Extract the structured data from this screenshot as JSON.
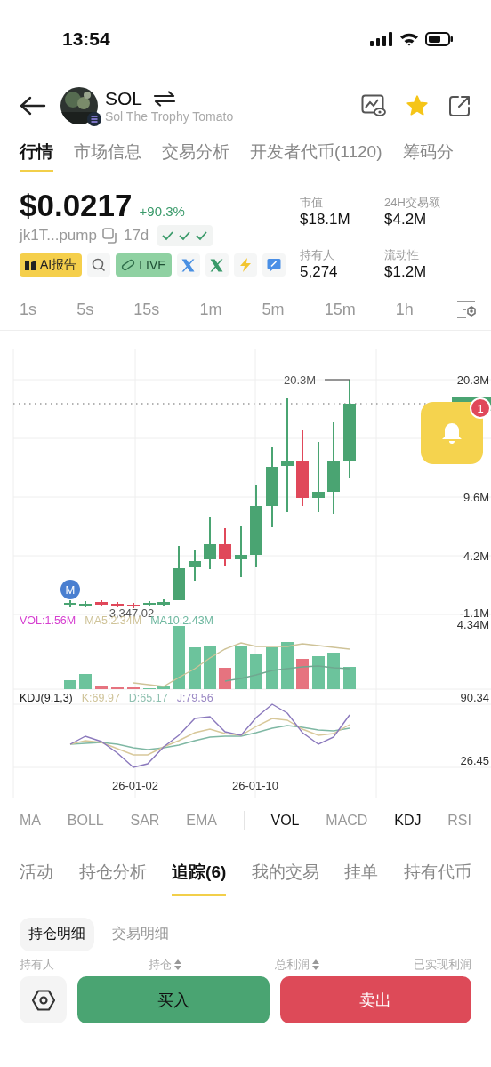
{
  "status_bar": {
    "time": "13:54"
  },
  "header": {
    "symbol": "SOL",
    "name": "Sol The Trophy Tomato",
    "starred": true
  },
  "tabs": [
    {
      "label": "行情",
      "selected": true
    },
    {
      "label": "市场信息",
      "selected": false
    },
    {
      "label": "交易分析",
      "selected": false
    },
    {
      "label": "开发者代币(1120)",
      "selected": false
    },
    {
      "label": "筹码分",
      "selected": false
    }
  ],
  "price": {
    "value": "$0.0217",
    "change": "+90.3%",
    "address": "jk1T...pump",
    "age": "17d"
  },
  "badges": [
    {
      "kind": "report",
      "label": "AI报告"
    },
    {
      "kind": "search"
    },
    {
      "kind": "live",
      "label": "LIVE"
    },
    {
      "kind": "x",
      "color": "#4a90e2"
    },
    {
      "kind": "x",
      "color": "#3a9a6a"
    },
    {
      "kind": "bolt"
    },
    {
      "kind": "edit"
    }
  ],
  "stats": [
    {
      "label": "市值",
      "value": "$18.1M"
    },
    {
      "label": "24H交易额",
      "value": "$4.2M"
    },
    {
      "label": "持有人",
      "value": "5,274"
    },
    {
      "label": "流动性",
      "value": "$1.2M"
    }
  ],
  "timeframes": [
    "1s",
    "5s",
    "15s",
    "1m",
    "5m",
    "15m",
    "1h"
  ],
  "chart": {
    "high_label": "20.3M",
    "low_label": "3,347.02",
    "marker": "M",
    "alert_count": "1",
    "price_axis": [
      "20.3M",
      "9.6M",
      "4.2M",
      "-1.1M"
    ],
    "volume": {
      "axis": "4.34M",
      "legend": [
        {
          "label": "VOL:1.56M",
          "color": "#d63fd0"
        },
        {
          "label": "MA5:2.34M",
          "color": "#cfc398"
        },
        {
          "label": "MA10:2.43M",
          "color": "#6fb8a0"
        }
      ]
    },
    "kdj": {
      "axis": [
        "90.34",
        "26.45"
      ],
      "legend": [
        {
          "label": "KDJ(9,1,3)",
          "color": "#222222"
        },
        {
          "label": "K:69.97",
          "color": "#cfc398"
        },
        {
          "label": "D:65.17",
          "color": "#8fc0b0"
        },
        {
          "label": "J:79.56",
          "color": "#9a88c4"
        }
      ]
    },
    "dates": [
      "26-01-02",
      "26-01-10"
    ]
  },
  "main_indicators": [
    {
      "label": "MA",
      "selected": false
    },
    {
      "label": "BOLL",
      "selected": false
    },
    {
      "label": "SAR",
      "selected": false
    },
    {
      "label": "EMA",
      "selected": false
    }
  ],
  "sub_indicators": [
    {
      "label": "VOL",
      "selected": true
    },
    {
      "label": "MACD",
      "selected": false
    },
    {
      "label": "KDJ",
      "selected": true
    },
    {
      "label": "RSI",
      "selected": false
    }
  ],
  "bottom_tabs": [
    {
      "label": "活动",
      "selected": false
    },
    {
      "label": "持仓分析",
      "selected": false
    },
    {
      "label": "追踪(6)",
      "selected": true
    },
    {
      "label": "我的交易",
      "selected": false
    },
    {
      "label": "挂单",
      "selected": false
    },
    {
      "label": "持有代币",
      "selected": false
    }
  ],
  "sub_tabs": [
    {
      "label": "持仓明细",
      "selected": true
    },
    {
      "label": "交易明细",
      "selected": false
    }
  ],
  "table": {
    "columns": [
      {
        "label": "持有人",
        "sortable": false
      },
      {
        "label": "持仓",
        "sortable": true
      },
      {
        "label": "总利润",
        "sortable": true
      },
      {
        "label": "已实现利润",
        "sortable": false
      }
    ]
  },
  "actions": {
    "buy": "买入",
    "sell": "卖出"
  }
}
